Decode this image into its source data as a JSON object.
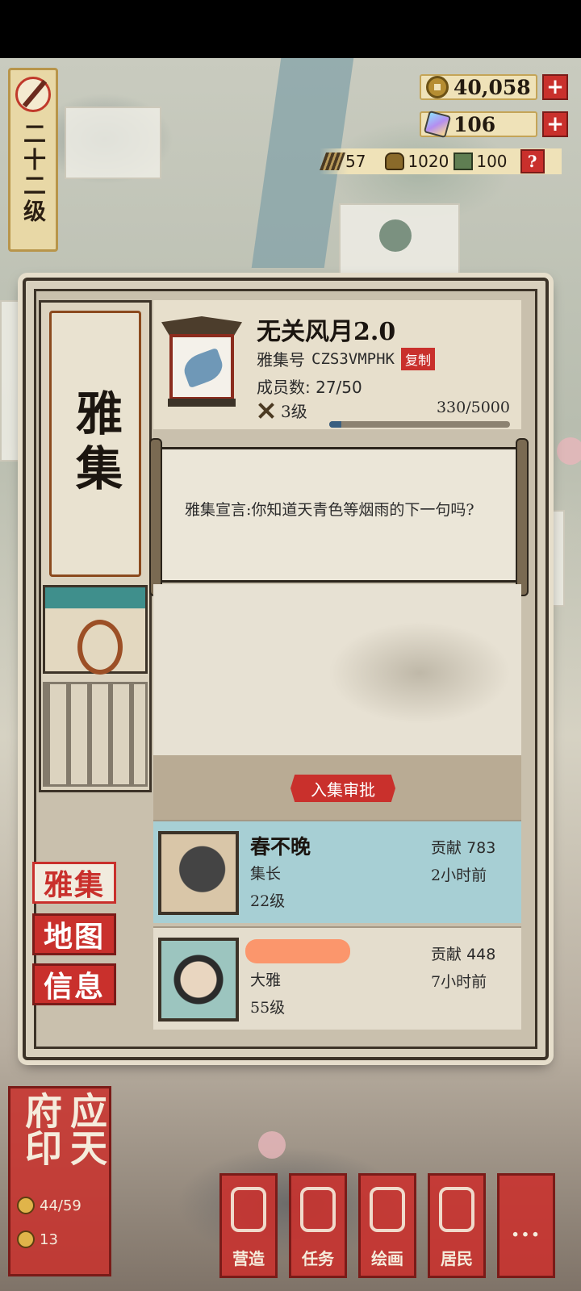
{
  "player": {
    "level_label": "二十二级"
  },
  "currency": {
    "coins": "40,058",
    "jade": "106",
    "wood": "57",
    "grain": "1020",
    "books": "100",
    "help_label": "?"
  },
  "panel": {
    "title": "雅集",
    "guild": {
      "name": "无关风月2.0",
      "id_label": "雅集号",
      "id_value": "CZS3VMPHK",
      "copy_label": "复制",
      "members_label": "成员数:",
      "members_value": "27/50",
      "level": "3级",
      "exp_text": "330/5000",
      "exp_progress": 0.066
    },
    "declaration": "雅集宣言:你知道天青色等烟雨的下一句吗?",
    "approve_label": "入集审批",
    "members": [
      {
        "name": "春不晚",
        "role": "集长",
        "level": "22级",
        "contrib_label": "贡献",
        "contrib_value": "783",
        "time": "2小时前"
      },
      {
        "name": "",
        "role": "大雅",
        "level": "55级",
        "contrib_label": "贡献",
        "contrib_value": "448",
        "time": "7小时前"
      }
    ],
    "tabs": [
      {
        "label": "雅集",
        "active": true
      },
      {
        "label": "地图",
        "active": false
      },
      {
        "label": "信息",
        "active": false
      }
    ]
  },
  "city": {
    "name": "应天府印",
    "stat1": "44/59",
    "stat2": "13"
  },
  "bottom_nav": [
    {
      "label": "营造",
      "icon": "build-icon"
    },
    {
      "label": "任务",
      "icon": "task-icon"
    },
    {
      "label": "绘画",
      "icon": "paint-icon"
    },
    {
      "label": "居民",
      "icon": "resident-icon"
    },
    {
      "label": "...",
      "icon": "more-icon"
    }
  ],
  "colors": {
    "accent_red": "#c9302c",
    "highlight_row": "#a7cfd4",
    "parchment": "#e7dfcc"
  }
}
